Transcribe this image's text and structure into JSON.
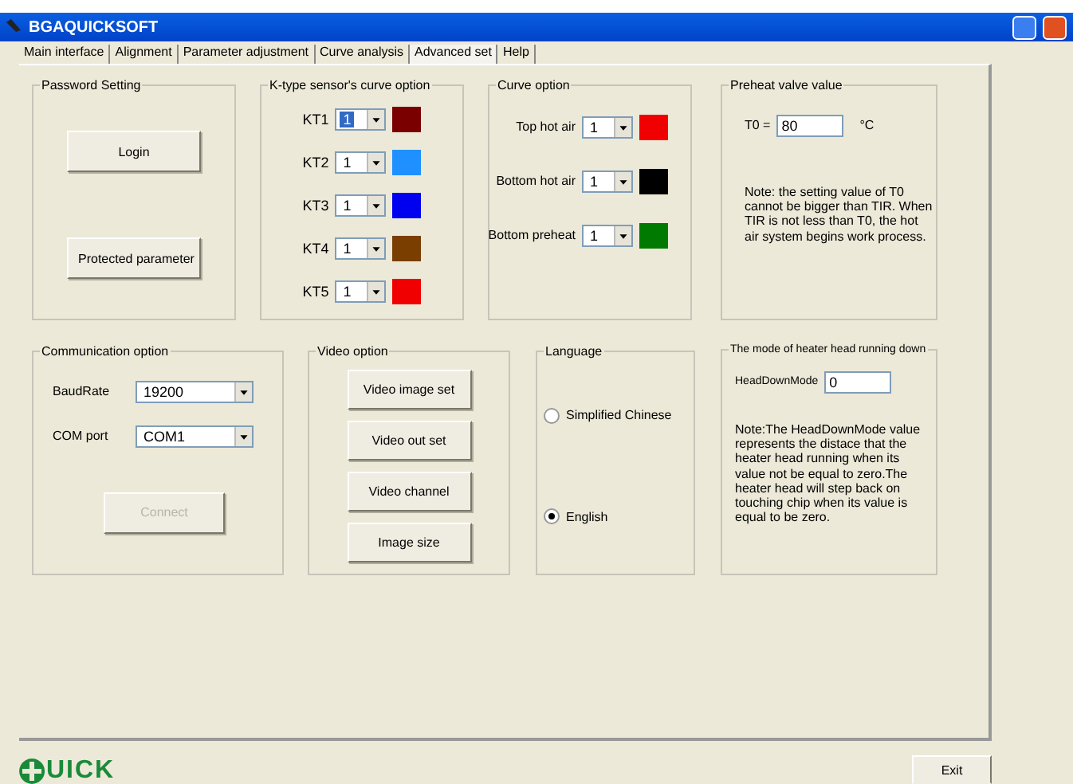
{
  "window": {
    "title": "BGAQUICKSOFT"
  },
  "tabs": [
    {
      "label": "Main interface",
      "selected": false
    },
    {
      "label": "Alignment",
      "selected": false
    },
    {
      "label": "Parameter adjustment",
      "selected": false
    },
    {
      "label": "Curve analysis",
      "selected": false
    },
    {
      "label": "Advanced set",
      "selected": true
    },
    {
      "label": "Help",
      "selected": false
    }
  ],
  "password_setting": {
    "title": "Password Setting",
    "buttons": [
      {
        "label": "Login",
        "disabled": false
      },
      {
        "label": "Protected parameter",
        "disabled": false
      }
    ]
  },
  "sensor_curve_option": {
    "title": "K-type sensor's curve option",
    "rows": [
      {
        "label": "KT1",
        "value": "1",
        "selected": true,
        "color": "#7a0000"
      },
      {
        "label": "KT2",
        "value": "1",
        "selected": false,
        "color": "#1e90ff"
      },
      {
        "label": "KT3",
        "value": "1",
        "selected": false,
        "color": "#0000f0"
      },
      {
        "label": "KT4",
        "value": "1",
        "selected": false,
        "color": "#7a3e00"
      },
      {
        "label": "KT5",
        "value": "1",
        "selected": false,
        "color": "#f00000"
      }
    ]
  },
  "curve_option": {
    "title": "Curve option",
    "rows": [
      {
        "label": "Top hot air",
        "value": "1",
        "color": "#f00000"
      },
      {
        "label": "Bottom hot air",
        "value": "1",
        "color": "#000000"
      },
      {
        "label": "Bottom preheat",
        "value": "1",
        "color": "#007a00"
      }
    ]
  },
  "preheat_valve": {
    "title": "Preheat valve value",
    "label": "T0 =",
    "value": "80",
    "unit": "°C",
    "note": "Note: the setting value of T0 cannot be bigger than TIR. When TIR is not less than T0, the hot air system begins work process."
  },
  "communication_option": {
    "title": "Communication option",
    "fields": [
      {
        "label": "BaudRate",
        "value": "19200"
      },
      {
        "label": "COM port",
        "value": "COM1"
      }
    ],
    "button": {
      "label": "Connect",
      "disabled": true
    }
  },
  "video_option": {
    "title": "Video option",
    "buttons": [
      "Video image set",
      "Video out set",
      "Video channel",
      "Image size"
    ]
  },
  "language": {
    "title": "Language",
    "options": [
      {
        "label": "Simplified Chinese",
        "selected": false
      },
      {
        "label": "English",
        "selected": true
      }
    ]
  },
  "heater_head": {
    "title": "The mode of heater head running down",
    "label": "HeadDownMode",
    "value": "0",
    "note": "Note:The HeadDownMode value represents the distace that the heater head running when its value not be equal to zero.The heater head will step back on touching chip when its value is equal to be zero."
  },
  "footer": {
    "logo_text": "UICK",
    "exit_button": "Exit"
  }
}
